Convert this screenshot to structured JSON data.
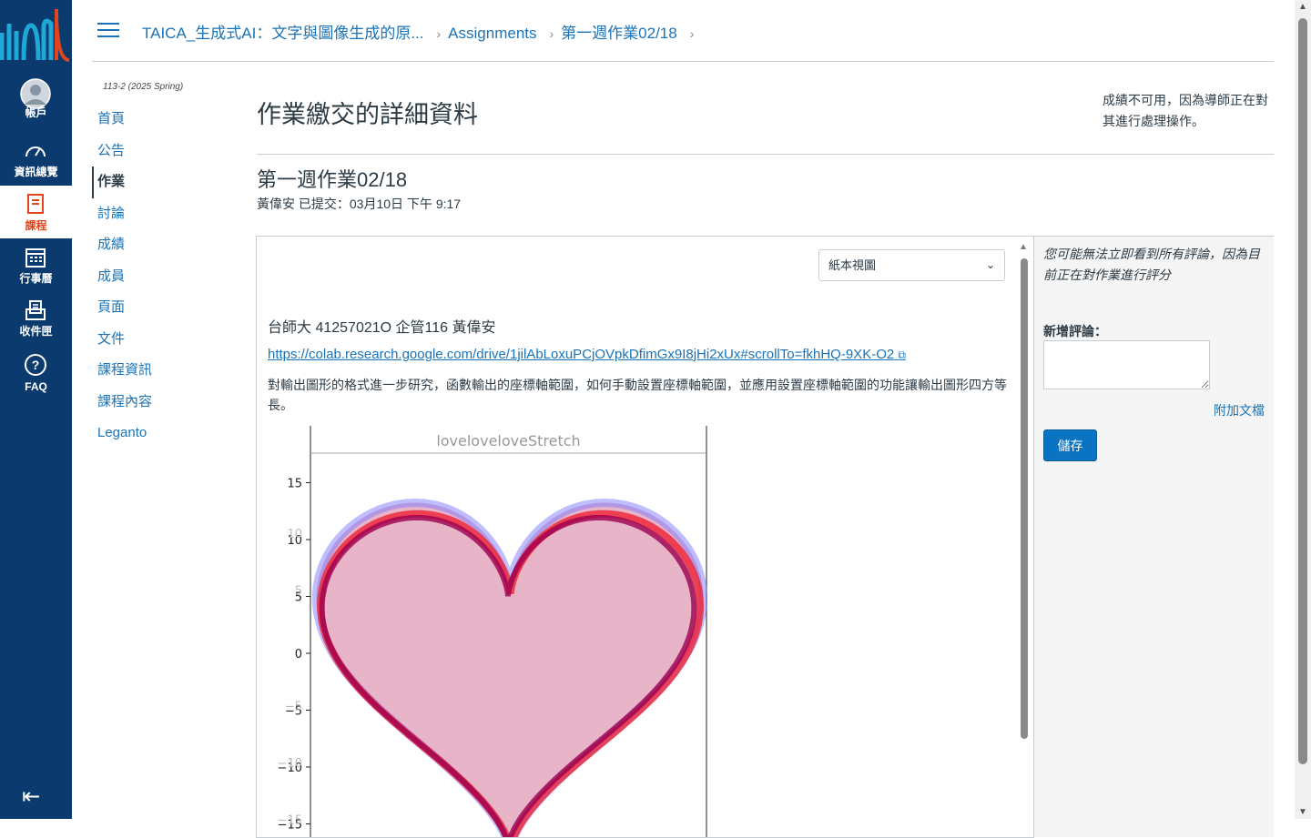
{
  "global_nav": {
    "items": [
      {
        "label": "帳戶",
        "icon": "account-avatar-icon"
      },
      {
        "label": "資訊總覽",
        "icon": "dashboard-icon"
      },
      {
        "label": "課程",
        "icon": "courses-icon",
        "active": true
      },
      {
        "label": "行事曆",
        "icon": "calendar-icon"
      },
      {
        "label": "收件匣",
        "icon": "inbox-icon"
      },
      {
        "label": "FAQ",
        "icon": "help-icon"
      }
    ],
    "collapse_icon": "collapse-nav-icon",
    "colors": {
      "bg": "#0b3a6e",
      "active_text": "#e0451f"
    }
  },
  "breadcrumb": {
    "course": "TAICA_生成式AI：文字與圖像生成的原...",
    "section": "Assignments",
    "assignment": "第一週作業02/18"
  },
  "course_nav": {
    "term": "113-2 (2025 Spring)",
    "items": [
      "首頁",
      "公告",
      "作業",
      "討論",
      "成績",
      "成員",
      "頁面",
      "文件",
      "課程資訊",
      "課程內容",
      "Leganto"
    ],
    "active_index": 2
  },
  "page": {
    "title": "作業繳交的詳細資料",
    "grade_note": "成績不可用，因為導師正在對其進行處理操作。",
    "assignment_title": "第一週作業02/18",
    "submitted_line": "黃偉安 已提交：03月10日 下午 9:17"
  },
  "submission": {
    "view_select": "紙本視圖",
    "student_line": "台師大  41257021O 企管116 黃偉安",
    "colab_link": "https://colab.research.google.com/drive/1jilAbLoxuPCjOVpkDfimGx9I8jHi2xUx#scrollTo=fkhHQ-9XK-O2",
    "description": "對輸出圖形的格式進一步研究，函數輸出的座標軸範圍，如何手動設置座標軸範圍，並應用設置座標軸範圍的功能讓輸出圖形四方等長。"
  },
  "chart_data": {
    "type": "line",
    "title": "loveloveloveStretch",
    "xlabel": "",
    "ylabel": "",
    "y_ticks": [
      15,
      10,
      5,
      0,
      -5,
      -10,
      -15
    ],
    "y_ticks_faded": [
      10,
      5,
      -5,
      -10,
      -15
    ],
    "ylim": [
      -16,
      16
    ],
    "series": [
      {
        "color": "#7b7bff",
        "fill": true
      },
      {
        "color": "#ee2233",
        "fill": false
      },
      {
        "color": "#9c0050",
        "fill": false
      }
    ],
    "fill_color": "#e8b4c8"
  },
  "side_panel": {
    "note": "您可能無法立即看到所有評論，因為目前正在對作業進行評分",
    "comment_label": "新增評論：",
    "attach_label": "附加文檔",
    "save_label": "儲存"
  }
}
